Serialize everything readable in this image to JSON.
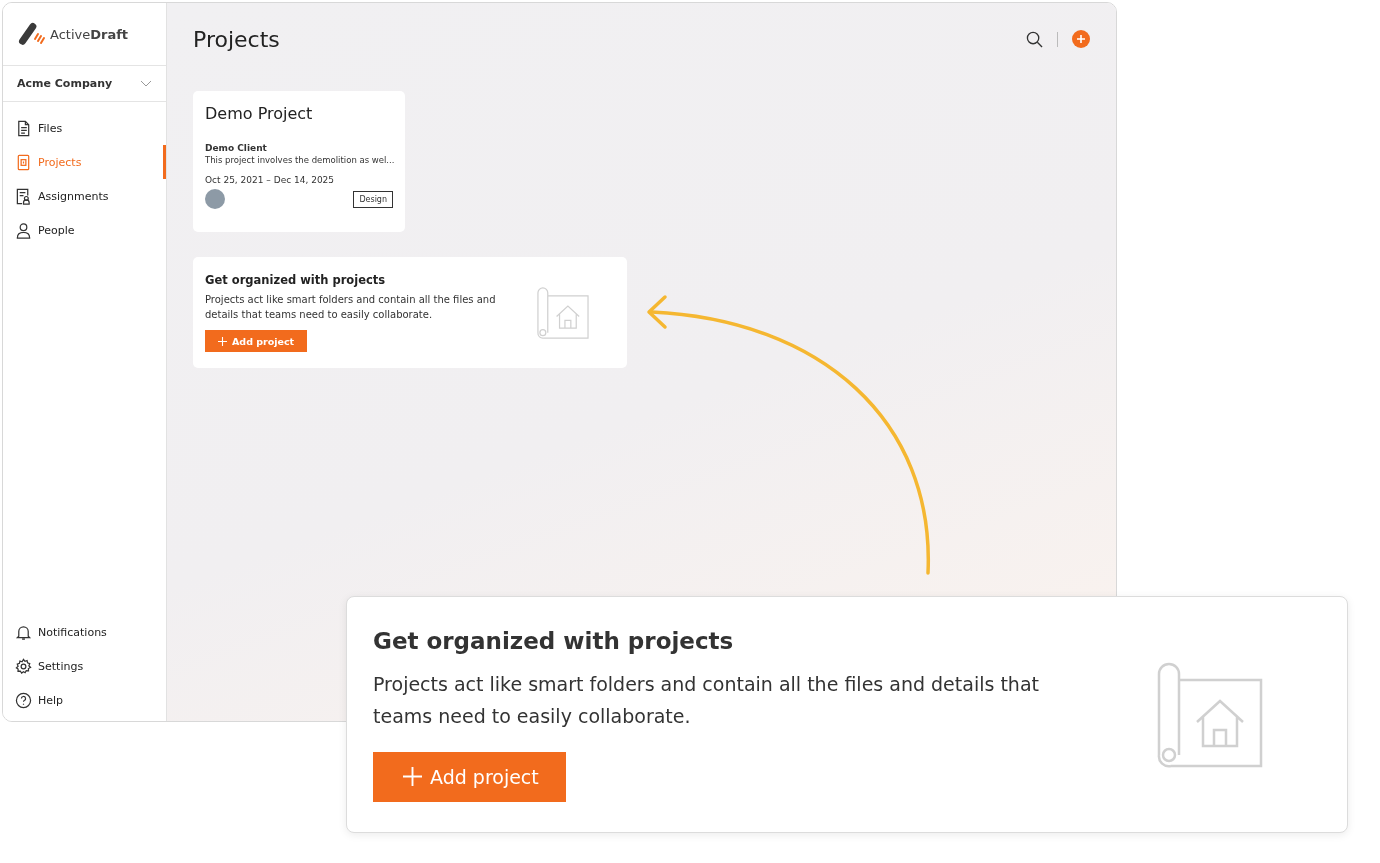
{
  "brand": {
    "name": "Active**Draft**"
  },
  "company_selector": {
    "label": "Acme Company"
  },
  "nav": [
    {
      "label": "Files",
      "selected": false
    },
    {
      "label": "Projects",
      "selected": true
    },
    {
      "label": "Assignments",
      "selected": false
    },
    {
      "label": "People",
      "selected": false
    }
  ],
  "nav_bottom": [
    {
      "label": "Notifications"
    },
    {
      "label": "Settings"
    },
    {
      "label": "Help"
    }
  ],
  "page": {
    "title": "Projects"
  },
  "project_cards": [
    {
      "title": "Demo Project",
      "client": "Demo Client",
      "description": "This project involves the demolition as wel...",
      "dates": "Oct 25, 2021 – Dec 14, 2025",
      "tag": "Design"
    }
  ],
  "empty_state": {
    "title": "Get organized with projects",
    "text": "Projects act like smart folders and contain all the files and details that teams need to easily collaborate.",
    "button": "Add project"
  },
  "callout": {
    "title": "Get organized with projects",
    "text": "Projects act like smart folders and contain all the files and details that teams need to easily collaborate.",
    "button": "Add project"
  }
}
